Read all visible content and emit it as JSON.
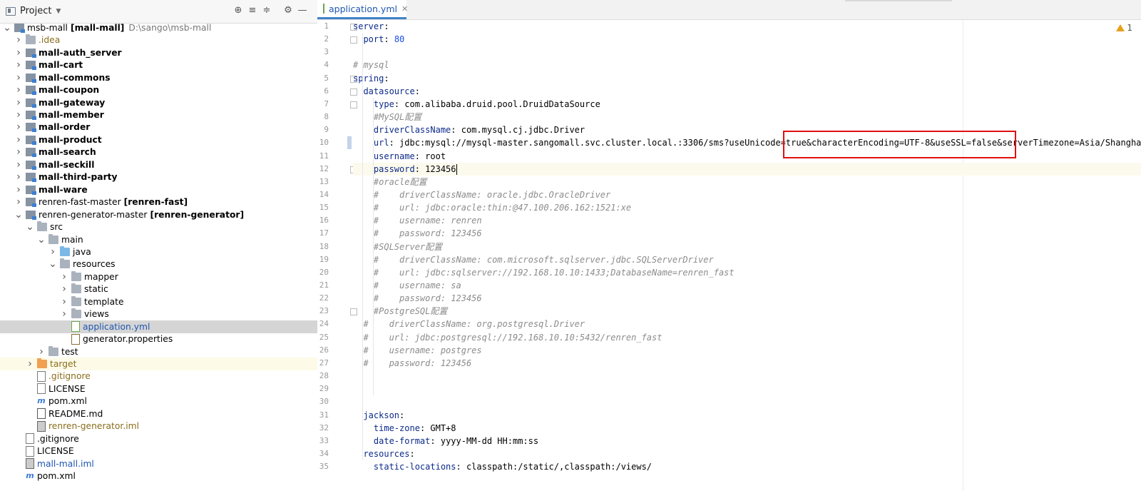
{
  "project_panel": {
    "title": "Project",
    "tree": [
      {
        "depth": 0,
        "chev": "v",
        "icon": "module",
        "label": "msb-mall",
        "bracket": "[mall-mall]",
        "path": "D:\\sango\\msb-mall",
        "style": ""
      },
      {
        "depth": 1,
        "chev": ">",
        "icon": "folder",
        "label": ".idea",
        "style": "brown"
      },
      {
        "depth": 1,
        "chev": ">",
        "icon": "module",
        "label": "mall-auth_server",
        "style": "bold"
      },
      {
        "depth": 1,
        "chev": ">",
        "icon": "module",
        "label": "mall-cart",
        "style": "bold"
      },
      {
        "depth": 1,
        "chev": ">",
        "icon": "module",
        "label": "mall-commons",
        "style": "bold"
      },
      {
        "depth": 1,
        "chev": ">",
        "icon": "module",
        "label": "mall-coupon",
        "style": "bold"
      },
      {
        "depth": 1,
        "chev": ">",
        "icon": "module",
        "label": "mall-gateway",
        "style": "bold"
      },
      {
        "depth": 1,
        "chev": ">",
        "icon": "module",
        "label": "mall-member",
        "style": "bold"
      },
      {
        "depth": 1,
        "chev": ">",
        "icon": "module",
        "label": "mall-order",
        "style": "bold"
      },
      {
        "depth": 1,
        "chev": ">",
        "icon": "module",
        "label": "mall-product",
        "style": "bold"
      },
      {
        "depth": 1,
        "chev": ">",
        "icon": "module",
        "label": "mall-search",
        "style": "bold"
      },
      {
        "depth": 1,
        "chev": ">",
        "icon": "module",
        "label": "mall-seckill",
        "style": "bold"
      },
      {
        "depth": 1,
        "chev": ">",
        "icon": "module",
        "label": "mall-third-party",
        "style": "bold"
      },
      {
        "depth": 1,
        "chev": ">",
        "icon": "module",
        "label": "mall-ware",
        "style": "bold"
      },
      {
        "depth": 1,
        "chev": ">",
        "icon": "module",
        "label": "renren-fast-master",
        "bracket": "[renren-fast]",
        "style": ""
      },
      {
        "depth": 1,
        "chev": "v",
        "icon": "module",
        "label": "renren-generator-master",
        "bracket": "[renren-generator]",
        "style": ""
      },
      {
        "depth": 2,
        "chev": "v",
        "icon": "folder",
        "label": "src",
        "style": ""
      },
      {
        "depth": 3,
        "chev": "v",
        "icon": "folder",
        "label": "main",
        "style": ""
      },
      {
        "depth": 4,
        "chev": ">",
        "icon": "folder-blue",
        "label": "java",
        "style": ""
      },
      {
        "depth": 4,
        "chev": "v",
        "icon": "folder",
        "label": "resources",
        "style": ""
      },
      {
        "depth": 5,
        "chev": ">",
        "icon": "folder",
        "label": "mapper",
        "style": ""
      },
      {
        "depth": 5,
        "chev": ">",
        "icon": "folder",
        "label": "static",
        "style": ""
      },
      {
        "depth": 5,
        "chev": ">",
        "icon": "folder",
        "label": "template",
        "style": ""
      },
      {
        "depth": 5,
        "chev": ">",
        "icon": "folder",
        "label": "views",
        "style": ""
      },
      {
        "depth": 5,
        "chev": "",
        "icon": "file-yml",
        "label": "application.yml",
        "style": "blue",
        "selected": true
      },
      {
        "depth": 5,
        "chev": "",
        "icon": "file-props",
        "label": "generator.properties",
        "style": ""
      },
      {
        "depth": 3,
        "chev": ">",
        "icon": "folder",
        "label": "test",
        "style": ""
      },
      {
        "depth": 2,
        "chev": ">",
        "icon": "folder-orange",
        "label": "target",
        "style": "brown",
        "highlight": true
      },
      {
        "depth": 2,
        "chev": "",
        "icon": "file",
        "label": ".gitignore",
        "style": "brown"
      },
      {
        "depth": 2,
        "chev": "",
        "icon": "file",
        "label": "LICENSE",
        "style": ""
      },
      {
        "depth": 2,
        "chev": "",
        "icon": "file-m",
        "label": "pom.xml",
        "style": ""
      },
      {
        "depth": 2,
        "chev": "",
        "icon": "file-md",
        "label": "README.md",
        "style": ""
      },
      {
        "depth": 2,
        "chev": "",
        "icon": "file-iml",
        "label": "renren-generator.iml",
        "style": "brown"
      },
      {
        "depth": 1,
        "chev": "",
        "icon": "file",
        "label": ".gitignore",
        "style": ""
      },
      {
        "depth": 1,
        "chev": "",
        "icon": "file",
        "label": "LICENSE",
        "style": ""
      },
      {
        "depth": 1,
        "chev": "",
        "icon": "file-iml",
        "label": "mall-mall.iml",
        "style": "blue"
      },
      {
        "depth": 1,
        "chev": "",
        "icon": "file-m",
        "label": "pom.xml",
        "style": ""
      }
    ]
  },
  "editor": {
    "tab_label": "application.yml",
    "warning_count": "1",
    "current_line": 12,
    "lines": [
      [
        [
          "k",
          "server"
        ],
        [
          "v",
          ":"
        ]
      ],
      [
        [
          "v",
          "  "
        ],
        [
          "k",
          "port"
        ],
        [
          "v",
          ": "
        ],
        [
          "n",
          "80"
        ]
      ],
      [],
      [
        [
          "c",
          "# mysql"
        ]
      ],
      [
        [
          "k",
          "spring"
        ],
        [
          "v",
          ":"
        ]
      ],
      [
        [
          "v",
          "  "
        ],
        [
          "k",
          "datasource"
        ],
        [
          "v",
          ":"
        ]
      ],
      [
        [
          "v",
          "    "
        ],
        [
          "k",
          "type"
        ],
        [
          "v",
          ": com.alibaba.druid.pool.DruidDataSource"
        ]
      ],
      [
        [
          "v",
          "    "
        ],
        [
          "c",
          "#MySQL配置"
        ]
      ],
      [
        [
          "v",
          "    "
        ],
        [
          "k",
          "driverClassName"
        ],
        [
          "v",
          ": com.mysql.cj.jdbc.Driver"
        ]
      ],
      [
        [
          "v",
          "    "
        ],
        [
          "k",
          "url"
        ],
        [
          "v",
          ": jdbc:mysql://mysql-master.sangomall.svc.cluster.local.:3306/sms?useUnicode=true&characterEncoding=UTF-8&useSSL=false&serverTimezone=Asia/Shanghai"
        ]
      ],
      [
        [
          "v",
          "    "
        ],
        [
          "k",
          "username"
        ],
        [
          "v",
          ": root"
        ]
      ],
      [
        [
          "v",
          "    "
        ],
        [
          "k",
          "password"
        ],
        [
          "v",
          ": 123456"
        ]
      ],
      [
        [
          "v",
          "    "
        ],
        [
          "c",
          "#oracle配置"
        ]
      ],
      [
        [
          "v",
          "    "
        ],
        [
          "c",
          "#    driverClassName: oracle.jdbc.OracleDriver"
        ]
      ],
      [
        [
          "v",
          "    "
        ],
        [
          "c",
          "#    url: jdbc:oracle:thin:@47.100.206.162:1521:xe"
        ]
      ],
      [
        [
          "v",
          "    "
        ],
        [
          "c",
          "#    username: renren"
        ]
      ],
      [
        [
          "v",
          "    "
        ],
        [
          "c",
          "#    password: 123456"
        ]
      ],
      [
        [
          "v",
          "    "
        ],
        [
          "c",
          "#SQLServer配置"
        ]
      ],
      [
        [
          "v",
          "    "
        ],
        [
          "c",
          "#    driverClassName: com.microsoft.sqlserver.jdbc.SQLServerDriver"
        ]
      ],
      [
        [
          "v",
          "    "
        ],
        [
          "c",
          "#    url: jdbc:sqlserver://192.168.10.10:1433;DatabaseName=renren_fast"
        ]
      ],
      [
        [
          "v",
          "    "
        ],
        [
          "c",
          "#    username: sa"
        ]
      ],
      [
        [
          "v",
          "    "
        ],
        [
          "c",
          "#    password: 123456"
        ]
      ],
      [
        [
          "v",
          "    "
        ],
        [
          "c",
          "#PostgreSQL配置"
        ]
      ],
      [
        [
          "v",
          "  "
        ],
        [
          "c",
          "#    driverClassName: org.postgresql.Driver"
        ]
      ],
      [
        [
          "v",
          "  "
        ],
        [
          "c",
          "#    url: jdbc:postgresql://192.168.10.10:5432/renren_fast"
        ]
      ],
      [
        [
          "v",
          "  "
        ],
        [
          "c",
          "#    username: postgres"
        ]
      ],
      [
        [
          "v",
          "  "
        ],
        [
          "c",
          "#    password: 123456"
        ]
      ],
      [],
      [],
      [],
      [
        [
          "v",
          "  "
        ],
        [
          "k",
          "jackson"
        ],
        [
          "v",
          ":"
        ]
      ],
      [
        [
          "v",
          "    "
        ],
        [
          "k",
          "time-zone"
        ],
        [
          "v",
          ": GMT+8"
        ]
      ],
      [
        [
          "v",
          "    "
        ],
        [
          "k",
          "date-format"
        ],
        [
          "v",
          ": yyyy-MM-dd HH:mm:ss"
        ]
      ],
      [
        [
          "v",
          "  "
        ],
        [
          "k",
          "resources"
        ],
        [
          "v",
          ":"
        ]
      ],
      [
        [
          "v",
          "    "
        ],
        [
          "k",
          "static-locations"
        ],
        [
          "v",
          ": classpath:/static/,classpath:/views/"
        ]
      ]
    ]
  }
}
